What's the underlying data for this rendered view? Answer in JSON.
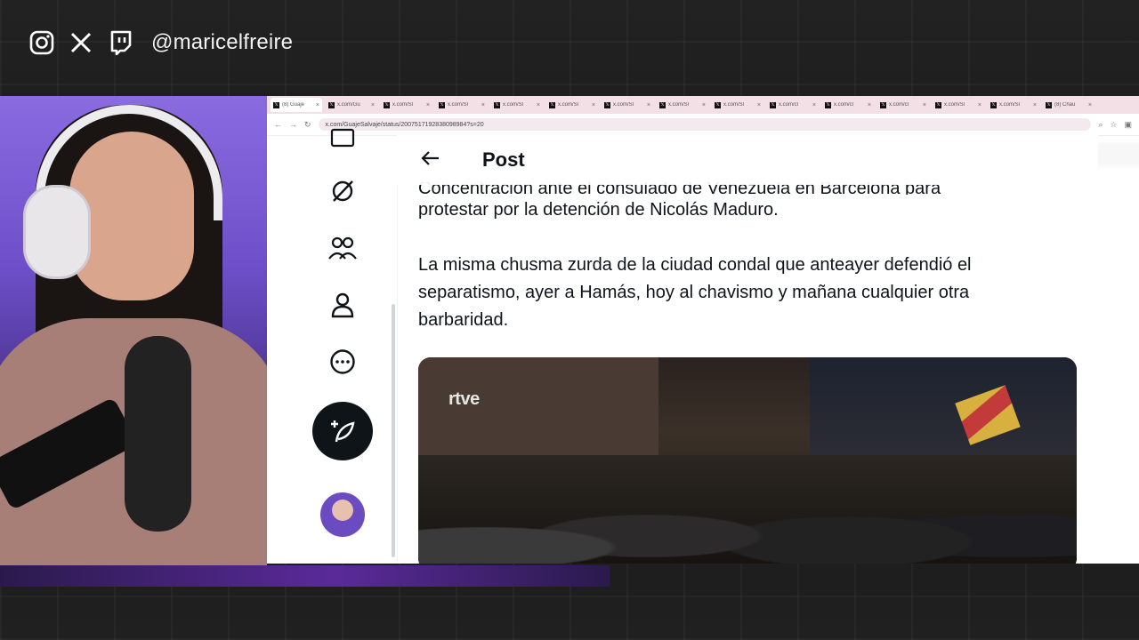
{
  "overlay": {
    "handle": "@maricelfreire",
    "icons": [
      "instagram-icon",
      "x-icon",
      "twitch-icon"
    ]
  },
  "browser": {
    "tabs": [
      {
        "label": "(8) Guaje",
        "active": true
      },
      {
        "label": "x.com/Gu"
      },
      {
        "label": "x.com/Sl"
      },
      {
        "label": "x.com/Sl"
      },
      {
        "label": "x.com/Sl"
      },
      {
        "label": "x.com/Sl"
      },
      {
        "label": "x.com/Sl"
      },
      {
        "label": "x.com/Sl"
      },
      {
        "label": "x.com/Sl"
      },
      {
        "label": "x.com/cl"
      },
      {
        "label": "x.com/cl"
      },
      {
        "label": "x.com/cl"
      },
      {
        "label": "x.com/Sl"
      },
      {
        "label": "x.com/Sl"
      },
      {
        "label": "(8) Chau"
      }
    ],
    "url": "x.com/GuajeSalvaje/status/2007517192838098984?s=20"
  },
  "page": {
    "header_title": "Post",
    "cut_line": "Concentración ante el consulado de Venezuela en Barcelona para",
    "paragraph1": "protestar por la detención de Nicolás Maduro.",
    "paragraph2": "La misma chusma zurda de la ciudad condal que anteayer defendió el separatismo, ayer a Hamás, hoy al chavismo y mañana cualquier otra barbaridad.",
    "media_logo": "rtve"
  }
}
